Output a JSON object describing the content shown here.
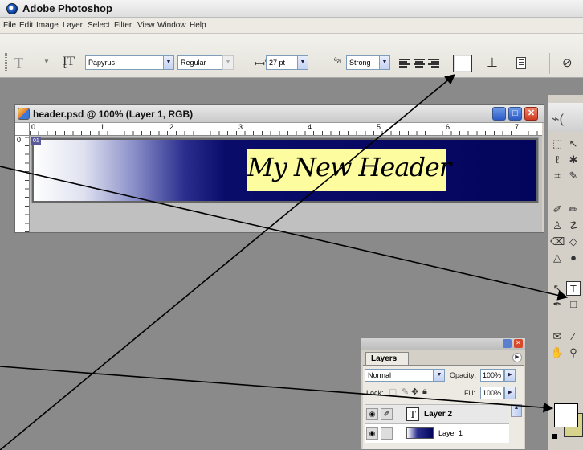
{
  "app": {
    "title": "Adobe Photoshop"
  },
  "menus": [
    "File",
    "Edit",
    "Image",
    "Layer",
    "Select",
    "Filter",
    "View",
    "Window",
    "Help"
  ],
  "options_bar": {
    "font_family": "Papyrus",
    "font_style": "Regular",
    "font_size": "27 pt",
    "antialias": "Strong",
    "text_color": "#ffffff"
  },
  "document": {
    "title": "header.psd @ 100% (Layer 1, RGB)",
    "ruler_h": [
      "0",
      "1",
      "2",
      "3",
      "4",
      "5",
      "6",
      "7"
    ],
    "ruler_v": "0",
    "slice_label": "01",
    "header_text": "My New Header",
    "text_highlight": "#fdfda0",
    "gradient_start": "#ffffff",
    "gradient_end": "#03055c"
  },
  "layers_panel": {
    "tab": "Layers",
    "blend_mode": "Normal",
    "opacity_label": "Opacity:",
    "opacity_value": "100%",
    "lock_label": "Lock:",
    "fill_label": "Fill:",
    "fill_value": "100%",
    "layers": [
      {
        "name": "Layer 2",
        "type": "text"
      },
      {
        "name": "Layer 1",
        "type": "image"
      }
    ]
  },
  "toolbox": {
    "foreground_color": "#ffffff",
    "background_color": "#d8d38c"
  },
  "annotation_color": "#000000"
}
